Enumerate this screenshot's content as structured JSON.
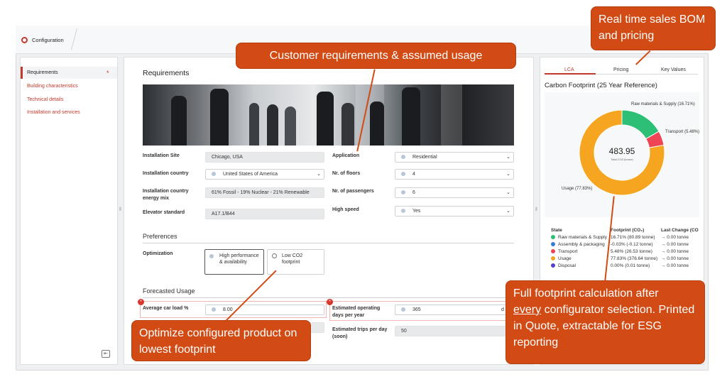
{
  "app": {
    "tab_title": "Configuration"
  },
  "sidebar": {
    "items": [
      {
        "label": "Requirements",
        "active": true,
        "required": "*"
      },
      {
        "label": "Building characteristics"
      },
      {
        "label": "Technical details"
      },
      {
        "label": "Installation and services"
      }
    ],
    "collapse_icon": "collapse-panel-icon"
  },
  "main": {
    "title": "Requirements",
    "fields": {
      "installation_site": {
        "label": "Installation Site",
        "value": "Chicago, USA"
      },
      "installation_country": {
        "label": "Installation country",
        "value": "United States of America"
      },
      "energy_mix": {
        "label": "Installation country energy mix",
        "value": "61% Fossil - 19% Nuclear - 21% Renewable"
      },
      "elevator_standard": {
        "label": "Elevator standard",
        "value": "A17.1/B44"
      },
      "application": {
        "label": "Application",
        "value": "Residential"
      },
      "floors": {
        "label": "Nr. of floors",
        "value": "4"
      },
      "passengers": {
        "label": "Nr. of passengers",
        "value": "6"
      },
      "high_speed": {
        "label": "High speed",
        "value": "Yes"
      }
    },
    "preferences": {
      "title": "Preferences",
      "optimization_label": "Optimization",
      "options": [
        "High performance & availability",
        "Low CO2 footprint"
      ]
    },
    "usage": {
      "title": "Forecasted Usage",
      "car_load": {
        "label": "Average car load %",
        "value": "8.00"
      },
      "operating_days": {
        "label": "Estimated operating days per year",
        "value": "365",
        "unit": "d"
      },
      "trips": {
        "label": "Estimated trips per day (soon)",
        "value": "50"
      }
    }
  },
  "right": {
    "tabs": [
      "LCA",
      "Pricing",
      "Key Values"
    ],
    "chart_title": "Carbon Footprint (25 Year Reference)",
    "total": "483.95",
    "total_caption": "Total CO2 (tonne)",
    "table_headers": [
      "State",
      "Footprint (CO₂)",
      "Last Change (CO"
    ],
    "rows": [
      {
        "state": "Raw materials & Supply",
        "footprint": "16.71% (80.89 tonne)",
        "change": "→ 0.00 tonne",
        "color": "#2dbf75"
      },
      {
        "state": "Assembly & packaging",
        "footprint": "-0.03% (-0.12 tonne)",
        "change": "→ 0.00 tonne",
        "color": "#3a7bd5"
      },
      {
        "state": "Transport",
        "footprint": "5.48% (26.53 tonne)",
        "change": "→ 0.00 tonne",
        "color": "#ee4455"
      },
      {
        "state": "Usage",
        "footprint": "77.83% (376.64 tonne)",
        "change": "→ 0.00 tonne",
        "color": "#f6a521"
      },
      {
        "state": "Disposal",
        "footprint": "0.00% (0.01 tonne)",
        "change": "→ 0.00 tonne",
        "color": "#5a3fcf"
      }
    ]
  },
  "chart_data": {
    "type": "pie",
    "title": "Carbon Footprint (25 Year Reference)",
    "categories": [
      "Raw materials & Supply",
      "Transport",
      "Usage"
    ],
    "values": [
      16.71,
      5.48,
      77.83
    ],
    "labels": [
      "Raw materials & Supply (16.71%)",
      "Transport (5.48%)",
      "Usage (77.83%)"
    ],
    "colors": [
      "#2dbf75",
      "#ee4455",
      "#f6a521"
    ]
  },
  "callouts": {
    "customer": "Customer requirements &  assumed usage",
    "sales": "Real time sales BOM and pricing",
    "optimize": "Optimize configured product on lowest footprint",
    "full": [
      "Full footprint calculation after",
      "every",
      " configurator selection. Printed in Quote, extractable for ESG reporting"
    ]
  }
}
